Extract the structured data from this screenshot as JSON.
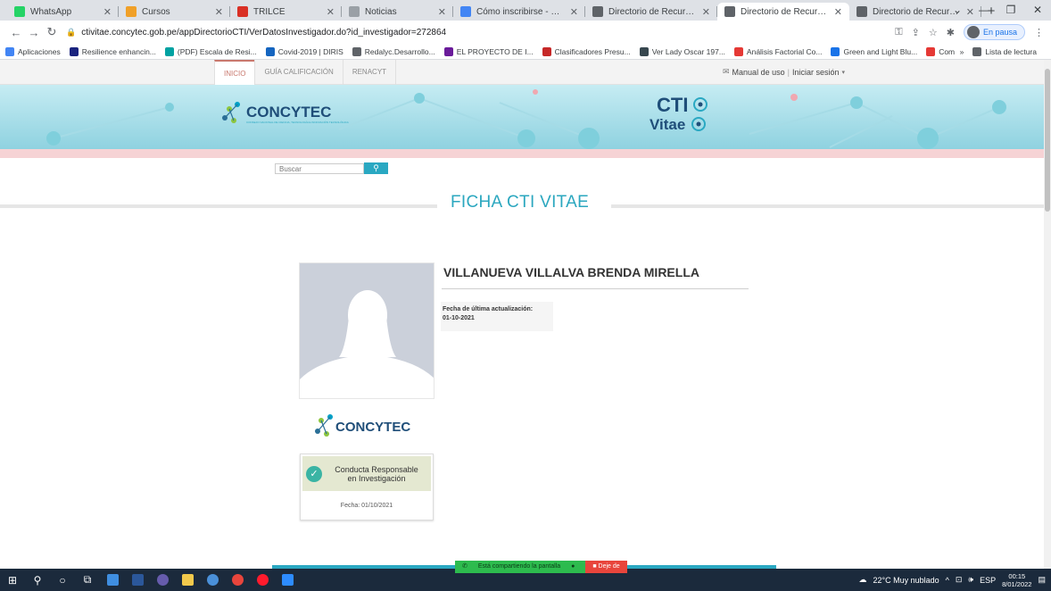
{
  "browser": {
    "tabs": [
      {
        "title": "WhatsApp",
        "icon": "whatsapp-icon",
        "color": "#25d366"
      },
      {
        "title": "Cursos",
        "icon": "moodle-icon",
        "color": "#f0a028"
      },
      {
        "title": "TRILCE",
        "icon": "trilce-icon",
        "color": "#d93025"
      },
      {
        "title": "Noticias",
        "icon": "news-icon",
        "color": "#9aa0a6"
      },
      {
        "title": "Cómo inscribirse - Manual",
        "icon": "doc-icon",
        "color": "#4285f4"
      },
      {
        "title": "Directorio de Recursos Hu",
        "icon": "globe-icon",
        "color": "#5f6368"
      },
      {
        "title": "Directorio de Recursos Hu",
        "icon": "globe-icon",
        "color": "#5f6368",
        "active": true
      },
      {
        "title": "Directorio de Recursos Hu",
        "icon": "globe-icon",
        "color": "#5f6368"
      }
    ],
    "new_tab": "+",
    "url": "ctivitae.concytec.gob.pe/appDirectorioCTI/VerDatosInvestigador.do?id_investigador=272864",
    "profile_status": "En pausa",
    "bookmarks": [
      {
        "label": "Aplicaciones",
        "color": "#4285f4"
      },
      {
        "label": "Resilience enhancin...",
        "color": "#1a237e"
      },
      {
        "label": "(PDF) Escala de Resi...",
        "color": "#00a2a2"
      },
      {
        "label": "Covid-2019 | DIRIS",
        "color": "#1565c0"
      },
      {
        "label": "Redalyc.Desarrollo...",
        "color": "#5f6368"
      },
      {
        "label": "EL PROYECTO DE I...",
        "color": "#6a1b9a"
      },
      {
        "label": "Clasificadores Presu...",
        "color": "#c62828"
      },
      {
        "label": "Ver Lady Oscar 197...",
        "color": "#37474f"
      },
      {
        "label": "Análisis Factorial Co...",
        "color": "#e53935"
      },
      {
        "label": "Green and Light Blu...",
        "color": "#1a73e8"
      },
      {
        "label": "Como instalar y...",
        "color": "#e53935"
      }
    ],
    "bookmarks_more": "»",
    "reading_list": "Lista de lectura"
  },
  "page": {
    "nav": [
      "INICIO",
      "GUÍA CALIFICACIÓN",
      "RENACYT"
    ],
    "manual": "Manual de uso",
    "login": "Iniciar sesión",
    "logo_text": "CONCYTEC",
    "logo_sub": "CONSEJO NACIONAL DE CIENCIA, TECNOLOGÍA E INNOVACIÓN TECNOLÓGICA",
    "cti_logo_line1": "CTI",
    "cti_logo_line2": "Vitae",
    "search_placeholder": "Buscar",
    "heading": "FICHA CTI VITAE",
    "researcher_name": "VILLANUEVA VILLALVA BRENDA MIRELLA",
    "update_label": "Fecha de última actualización:",
    "update_date": "01-10-2021",
    "cert_logo_text": "CONCYTEC",
    "cert_title_1": "Conducta Responsable",
    "cert_title_2": "en Investigación",
    "cert_date": "Fecha: 01/10/2021"
  },
  "share": {
    "sharing_text": "Está compartiendo la pantalla",
    "stop_text": "Deje de"
  },
  "taskbar": {
    "weather": "22°C  Muy nublado",
    "lang": "ESP",
    "time": "00:15",
    "date": "8/01/2022"
  }
}
